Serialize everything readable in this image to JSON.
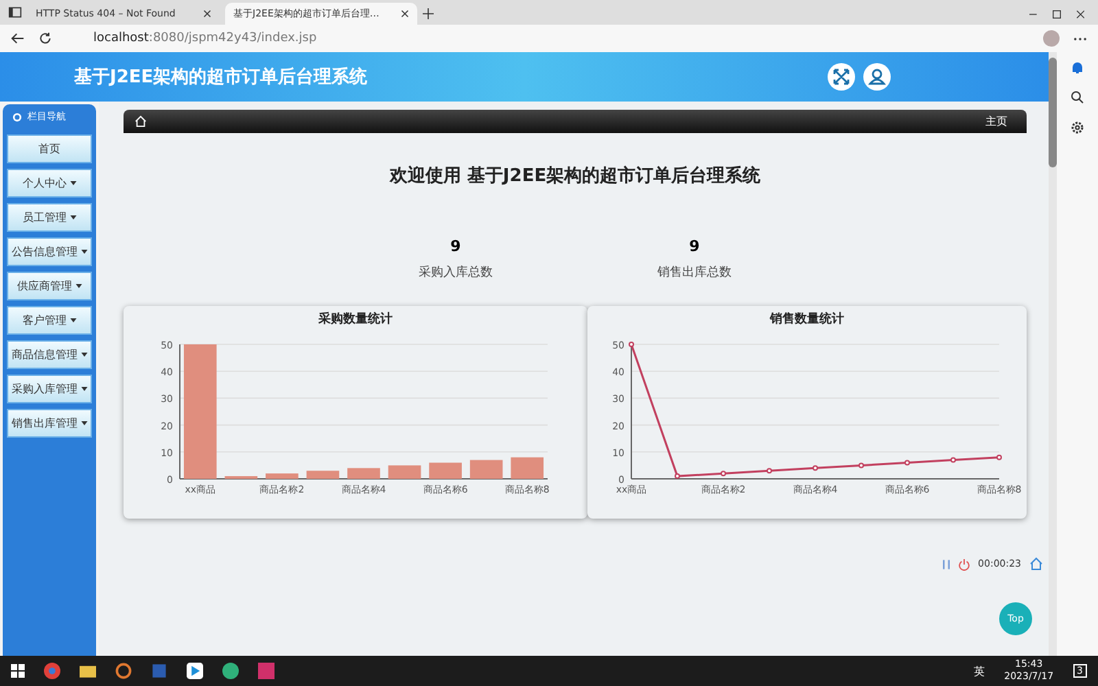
{
  "browser": {
    "tabs": [
      {
        "title": "HTTP Status 404 – Not Found",
        "selected": false
      },
      {
        "title": "基于J2EE架构的超市订单后台理…",
        "selected": true
      }
    ],
    "url_host": "localhost",
    "url_rest": ":8080/jspm42y43/index.jsp"
  },
  "header": {
    "title": "基于J2EE架构的超市订单后台理系统"
  },
  "sidebar": {
    "title": "栏目导航",
    "items": [
      {
        "label": "首页",
        "dropdown": false
      },
      {
        "label": "个人中心",
        "dropdown": true
      },
      {
        "label": "员工管理",
        "dropdown": true
      },
      {
        "label": "公告信息管理",
        "dropdown": true
      },
      {
        "label": "供应商管理",
        "dropdown": true
      },
      {
        "label": "客户管理",
        "dropdown": true
      },
      {
        "label": "商品信息管理",
        "dropdown": true
      },
      {
        "label": "采购入库管理",
        "dropdown": true
      },
      {
        "label": "销售出库管理",
        "dropdown": true
      }
    ]
  },
  "breadcrumb": {
    "right": "主页"
  },
  "welcome": "欢迎使用 基于J2EE架构的超市订单后台理系统",
  "stats": [
    {
      "value": "9",
      "label": "采购入库总数"
    },
    {
      "value": "9",
      "label": "销售出库总数"
    }
  ],
  "charts": [
    {
      "chart_data": {
        "type": "bar",
        "title": "采购数量统计",
        "categories": [
          "xx商品",
          null,
          "商品名称2",
          null,
          "商品名称4",
          null,
          "商品名称6",
          null,
          "商品名称8"
        ],
        "series": [
          {
            "color": "#e08e7e",
            "values": [
              50,
              1,
              2,
              3,
              4,
              5,
              6,
              7,
              8
            ]
          }
        ],
        "grid": true,
        "ylim": [
          0,
          50
        ],
        "yticks": [
          0,
          10,
          20,
          30,
          40,
          50
        ]
      }
    },
    {
      "chart_data": {
        "type": "line",
        "title": "销售数量统计",
        "categories": [
          "xx商品",
          null,
          "商品名称2",
          null,
          "商品名称4",
          null,
          "商品名称6",
          null,
          "商品名称8"
        ],
        "series": [
          {
            "color": "#c2405f",
            "marker": true,
            "values": [
              50,
              1,
              2,
              3,
              4,
              5,
              6,
              7,
              8
            ]
          }
        ],
        "grid": true,
        "ylim": [
          0,
          50
        ],
        "yticks": [
          0,
          10,
          20,
          30,
          40,
          50
        ]
      }
    }
  ],
  "recorder": {
    "time": "00:00:23"
  },
  "top_button": "Top",
  "taskbar": {
    "ime": "英",
    "time": "15:43",
    "date": "2023/7/17",
    "notifications": "3"
  }
}
